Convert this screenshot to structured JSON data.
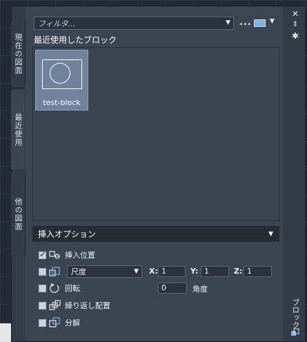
{
  "palette": {
    "filter_placeholder": "フィルタ...",
    "more_label": "...",
    "section_title": "最近使用したブロック",
    "tabs": [
      {
        "label": "現在の図面"
      },
      {
        "label": "最近使用"
      },
      {
        "label": "他の図面"
      }
    ],
    "blocks": [
      {
        "name": "test-block"
      }
    ],
    "side_label": "ブロック",
    "colors": {
      "accent_tile": "#6f839f",
      "background": "#3b4451"
    }
  },
  "options": {
    "header": "挿入オプション",
    "insertion_point": {
      "label": "挿入位置",
      "checked": true
    },
    "scale": {
      "select_value": "尺度",
      "x_label": "X:",
      "x_value": "1",
      "y_label": "Y:",
      "y_value": "1",
      "z_label": "Z:",
      "z_value": "1",
      "checked": false
    },
    "rotation": {
      "label": "回転",
      "value": "0",
      "unit_label": "角度",
      "checked": false
    },
    "repeat": {
      "label": "繰り返し配置",
      "checked": false
    },
    "explode": {
      "label": "分解",
      "checked": false
    }
  },
  "icons": {
    "view": "image-view-icon",
    "close": "close-icon",
    "autohide": "autohide-icon",
    "properties": "gear-icon",
    "bottom": "palette-icon"
  }
}
